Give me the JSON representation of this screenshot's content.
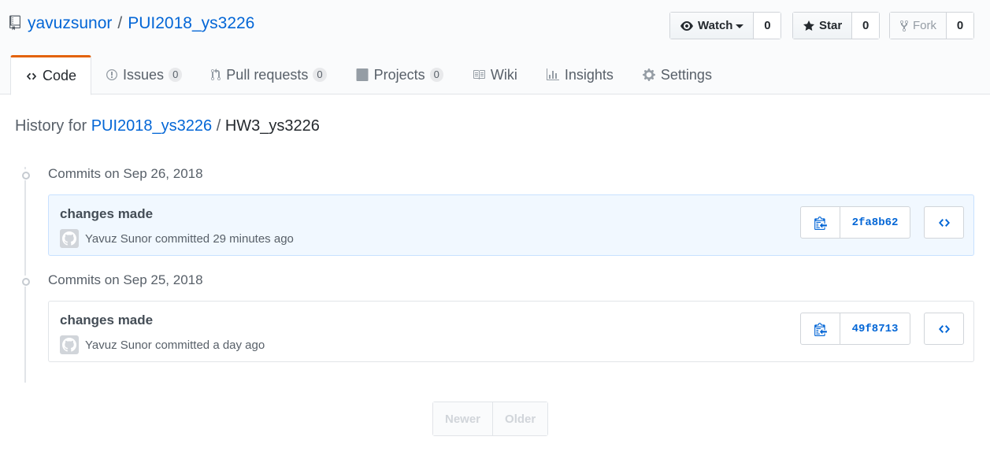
{
  "repo": {
    "owner": "yavuzsunor",
    "separator": "/",
    "name": "PUI2018_ys3226"
  },
  "actions": {
    "watch": {
      "label": "Watch",
      "count": "0"
    },
    "star": {
      "label": "Star",
      "count": "0"
    },
    "fork": {
      "label": "Fork",
      "count": "0"
    }
  },
  "tabs": [
    {
      "label": "Code",
      "icon": "code-icon",
      "selected": true
    },
    {
      "label": "Issues",
      "icon": "issue-icon",
      "count": "0"
    },
    {
      "label": "Pull requests",
      "icon": "pull-request-icon",
      "count": "0"
    },
    {
      "label": "Projects",
      "icon": "project-icon",
      "count": "0"
    },
    {
      "label": "Wiki",
      "icon": "book-icon"
    },
    {
      "label": "Insights",
      "icon": "graph-icon"
    },
    {
      "label": "Settings",
      "icon": "gear-icon"
    }
  ],
  "history": {
    "prefix": "History for",
    "repo_link": "PUI2018_ys3226",
    "separator": "/",
    "path": "HW3_ys3226"
  },
  "commit_groups": [
    {
      "title": "Commits on Sep 26, 2018",
      "commits": [
        {
          "message": "changes made",
          "author": "Yavuz Sunor",
          "action": "committed",
          "time": "29 minutes ago",
          "sha": "2fa8b62",
          "highlight": true
        }
      ]
    },
    {
      "title": "Commits on Sep 25, 2018",
      "commits": [
        {
          "message": "changes made",
          "author": "Yavuz Sunor",
          "action": "committed",
          "time": "a day ago",
          "sha": "49f8713",
          "highlight": false
        }
      ]
    }
  ],
  "pagination": {
    "newer": "Newer",
    "older": "Older"
  },
  "colors": {
    "link": "#0366d6",
    "accent": "#e36209"
  }
}
